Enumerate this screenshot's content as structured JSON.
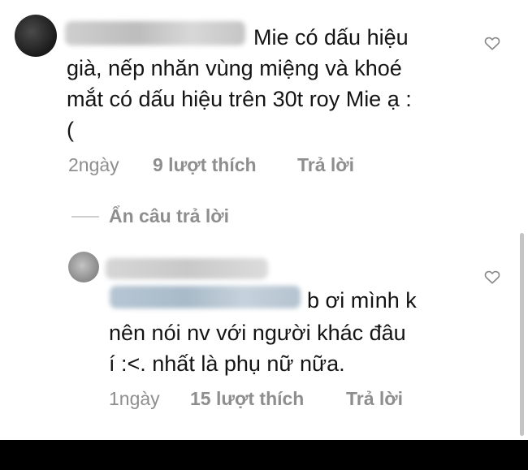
{
  "comments": [
    {
      "text_lines": [
        "Mie có dấu hiệu",
        "già, nếp nhăn vùng miệng và khoé",
        "mắt có dấu hiệu trên 30t roy Mie ạ :",
        "("
      ],
      "time": "2ngày",
      "likes": "9 lượt thích",
      "reply": "Trả lời"
    }
  ],
  "hide_replies": "Ẩn câu trả lời",
  "replies": [
    {
      "text_lines": [
        "b ơi mình k",
        "nên nói nv với người khác đâu",
        "í :<. nhất là phụ nữ nữa."
      ],
      "time": "1ngày",
      "likes": "15 lượt thích",
      "reply": "Trả lời"
    }
  ],
  "colors": {
    "text": "#141414",
    "meta": "#8e8e8e",
    "bottom_bar": "#000000"
  },
  "icons": [
    "heart-icon"
  ]
}
